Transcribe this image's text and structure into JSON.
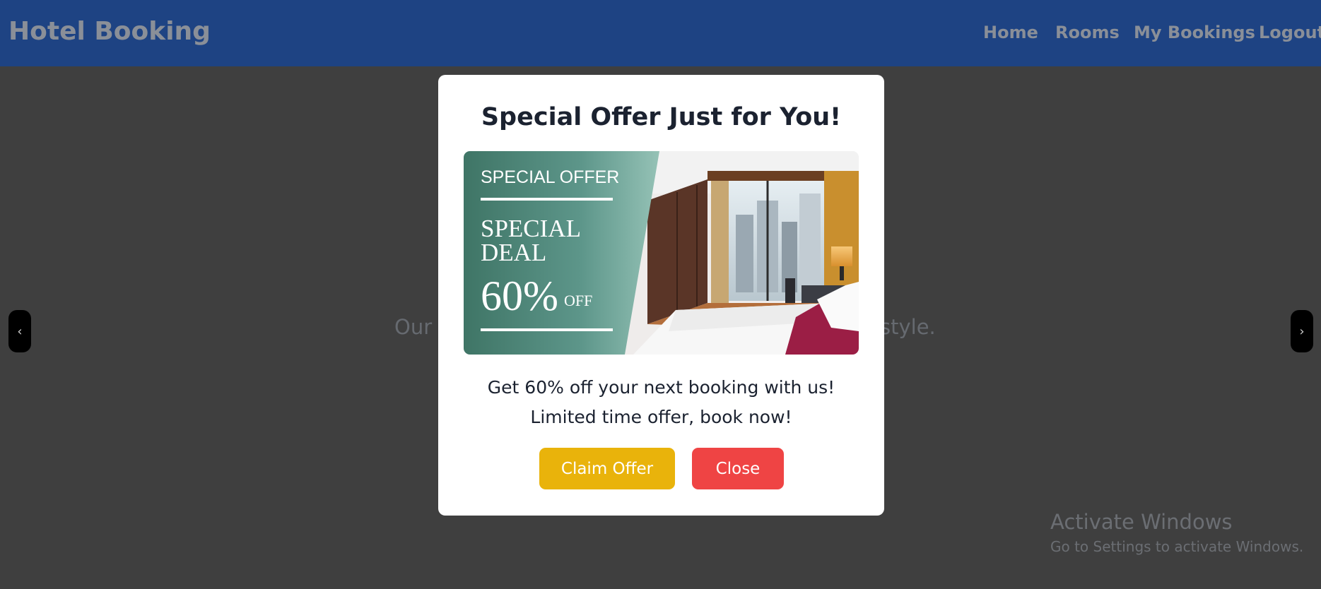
{
  "navbar": {
    "brand": "Hotel Booking",
    "links": [
      "Home",
      "Rooms",
      "My Bookings",
      "Logout"
    ],
    "background": "#1e4383"
  },
  "background_page": {
    "tagline_left": "Our r",
    "tagline_right": "style.",
    "carousel_prev": "‹",
    "carousel_next": "›"
  },
  "modal": {
    "title": "Special Offer Just for You!",
    "banner": {
      "header": "SPECIAL OFFER",
      "deal_line1": "SPECIAL",
      "deal_line2": "DEAL",
      "percent": "60%",
      "off": "OFF"
    },
    "line1": "Get 60% off your next booking with us!",
    "line2": "Limited time offer, book now!",
    "claim_label": "Claim Offer",
    "close_label": "Close",
    "claim_color": "#e9b30b",
    "close_color": "#ef4444"
  },
  "watermark": {
    "title": "Activate Windows",
    "subtitle": "Go to Settings to activate Windows."
  }
}
